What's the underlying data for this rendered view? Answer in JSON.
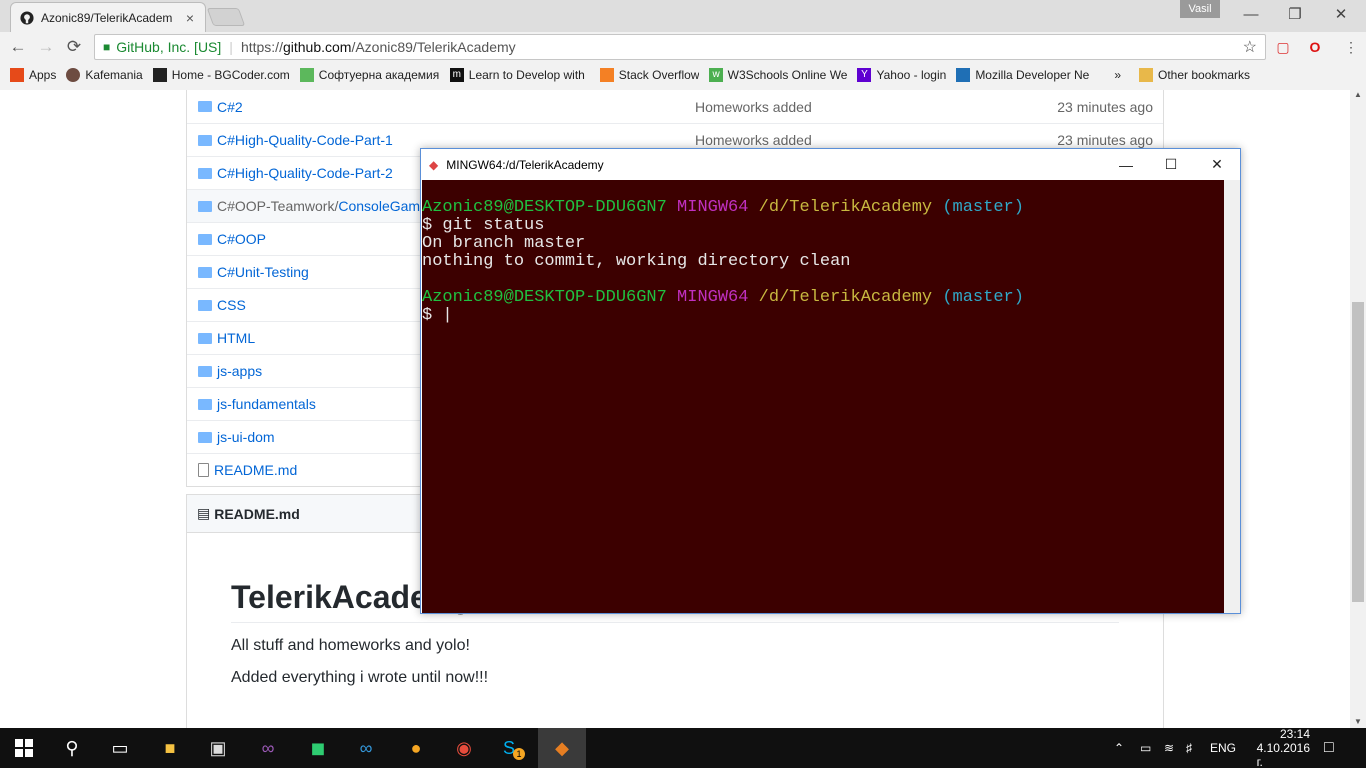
{
  "browser": {
    "tab_title": "Azonic89/TelerikAcadem",
    "tab_close": "×",
    "user": "Vasil",
    "win_min": "—",
    "win_restore": "❐",
    "win_close": "✕",
    "back": "←",
    "forward": "→",
    "reload": "⟳",
    "ev_name": "GitHub, Inc. [US]",
    "url_prefix": "https://",
    "url_host": "github.com",
    "url_path": "/Azonic89/TelerikAcademy",
    "star": "☆",
    "menu": "⋮"
  },
  "bookmarks": {
    "items": [
      {
        "label": "Apps",
        "icon": "apps-grid-icon",
        "color": "#e64a19"
      },
      {
        "label": "Kafemania",
        "icon": "coffee-icon",
        "color": "#6d4c41"
      },
      {
        "label": "Home - BGCoder.com",
        "icon": "bgcoder-icon",
        "color": "#222222"
      },
      {
        "label": "Софтуерна академия",
        "icon": "telerik-icon",
        "color": "#5cb85c"
      },
      {
        "label": "Learn to Develop with",
        "icon": "m-logo-icon",
        "color": "#111111"
      },
      {
        "label": "Stack Overflow",
        "icon": "stackoverflow-icon",
        "color": "#f48024"
      },
      {
        "label": "W3Schools Online We",
        "icon": "w3schools-icon",
        "color": "#4caf50"
      },
      {
        "label": "Yahoo - login",
        "icon": "yahoo-icon",
        "color": "#5f01d1"
      },
      {
        "label": "Mozilla Developer Ne",
        "icon": "mdn-icon",
        "color": "#1f6fb5"
      }
    ],
    "more": "»",
    "other": "Other bookmarks"
  },
  "files": [
    {
      "name": "C#2",
      "msg": "Homeworks added",
      "age": "23 minutes ago"
    },
    {
      "name": "C#High-Quality-Code-Part-1",
      "msg": "Homeworks added",
      "age": "23 minutes ago"
    },
    {
      "name": "C#High-Quality-Code-Part-2",
      "msg": "",
      "age": ""
    },
    {
      "name_prefix": "C#OOP-Teamwork/",
      "name": "ConsoleGame",
      "msg": "",
      "age": ""
    },
    {
      "name": "C#OOP",
      "msg": "",
      "age": ""
    },
    {
      "name": "C#Unit-Testing",
      "msg": "",
      "age": ""
    },
    {
      "name": "CSS",
      "msg": "",
      "age": ""
    },
    {
      "name": "HTML",
      "msg": "",
      "age": ""
    },
    {
      "name": "js-apps",
      "msg": "",
      "age": ""
    },
    {
      "name": "js-fundamentals",
      "msg": "",
      "age": ""
    },
    {
      "name": "js-ui-dom",
      "msg": "",
      "age": ""
    },
    {
      "name": "README.md",
      "msg": "",
      "age": ""
    }
  ],
  "readme": {
    "header": "README.md",
    "title": "TelerikAcademy",
    "p1": "All stuff and homeworks and yolo!",
    "p2": "Added everything i wrote until now!!!"
  },
  "terminal": {
    "title": "MINGW64:/d/TelerikAcademy",
    "user_host": "Azonic89@DESKTOP-DDU6GN7",
    "shell": "MINGW64",
    "path": "/d/TelerikAcademy",
    "branch": "(master)",
    "cmd": "$ git status",
    "out1": "On branch master",
    "out2": "nothing to commit, working directory clean",
    "prompt": "$ |"
  },
  "taskbar": {
    "lang": "ENG",
    "time": "23:14",
    "date": "4.10.2016 г.",
    "skype_badge": "1"
  }
}
